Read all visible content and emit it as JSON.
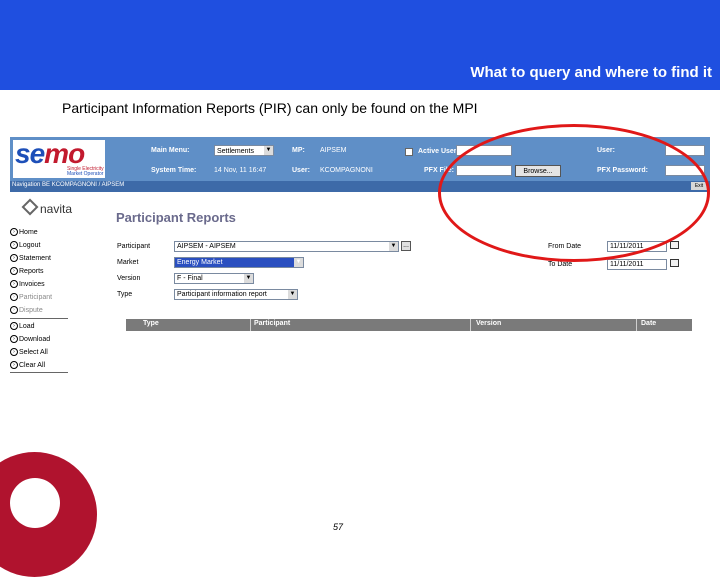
{
  "slide": {
    "title": "What to query and where to find it",
    "subtitle": "Participant Information Reports (PIR) can only be found on the MPI",
    "page_number": "57"
  },
  "colors": {
    "top_band": "#1f4fe0",
    "app_header": "#5f8fc7",
    "annotation": "#e01818",
    "logo_red": "#b0132e"
  },
  "app": {
    "logo": {
      "word_se": "se",
      "word_m": "m",
      "word_o": "o",
      "tagline_line1": "Single Electricity",
      "tagline_line2": "Market Operator"
    },
    "header": {
      "main_menu_label": "Main Menu:",
      "main_menu_value": "Settlements",
      "mp_label": "MP:",
      "mp_value": "AIPSEM",
      "active_user_label": "Active User",
      "user_label": "User:",
      "system_time_label": "System Time:",
      "system_time_value": "14 Nov, 11 16:47",
      "user2_label": "User:",
      "user2_value": "KCOMPAGNONI",
      "pfx_file_label": "PFX File:",
      "browse_label": "Browse...",
      "pfx_password_label": "PFX Password:"
    },
    "breadcrumb": {
      "text": "Navigation BE KCOMPAGNONI / AIPSEM",
      "button_label": "Exit"
    },
    "nav": {
      "logo_text": "navita",
      "items": [
        {
          "label": "Home"
        },
        {
          "label": "Logout"
        },
        {
          "label": "Statement"
        },
        {
          "label": "Reports"
        },
        {
          "label": "Invoices"
        },
        {
          "label": "Participant"
        },
        {
          "label": "Dispute"
        },
        {
          "label": "Load"
        },
        {
          "label": "Download"
        },
        {
          "label": "Select All"
        },
        {
          "label": "Clear All"
        }
      ]
    },
    "content": {
      "heading": "Participant Reports",
      "participant_label": "Participant",
      "participant_value": "AIPSEM - AIPSEM",
      "market_label": "Market",
      "market_value": "Energy Market",
      "version_label": "Version",
      "version_value": "F - Final",
      "type_label": "Type",
      "type_value": "Participant information report",
      "from_date_label": "From Date",
      "from_date_value": "11/11/2011",
      "to_date_label": "To Date",
      "to_date_value": "11/11/2011",
      "ellipsis_label": "..."
    },
    "table": {
      "columns": [
        "Type",
        "Participant",
        "Version",
        "Date"
      ]
    }
  }
}
